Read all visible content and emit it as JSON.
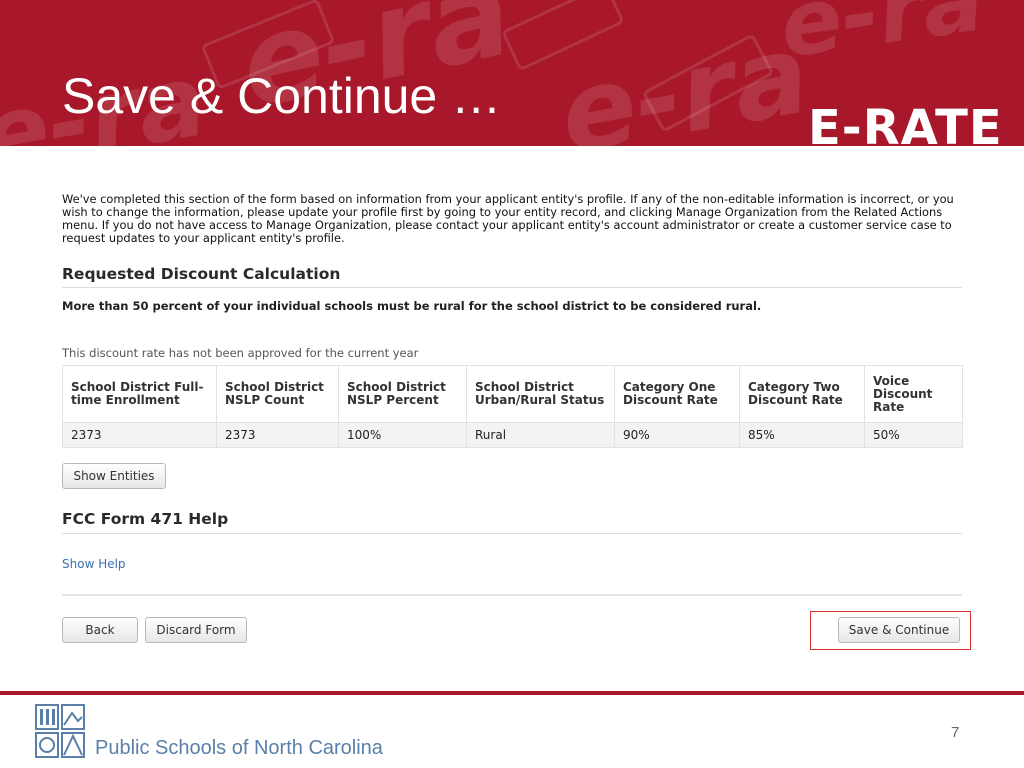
{
  "slide": {
    "title": "Save & Continue …",
    "brand": "E-RATE",
    "page_number": "7"
  },
  "form": {
    "intro": "We've completed this section of the form based on information from your applicant entity's profile.  If any of the non-editable information is incorrect, or you wish to change the information, please update your profile first by going to your entity record, and clicking Manage Organization from the Related Actions menu.  If you do not have access to Manage Organization, please contact your applicant entity's account administrator or create a customer service case to request updates to your applicant entity's profile.",
    "discount_section": {
      "heading": "Requested Discount Calculation",
      "rural_note": "More than 50 percent of your individual schools must be rural for the school district to be considered rural.",
      "approval_note": "This discount rate has not been approved for the current year",
      "table": {
        "headers": [
          "School District Full-time Enrollment",
          "School District NSLP Count",
          "School District NSLP Percent",
          "School District Urban/Rural Status",
          "Category One Discount Rate",
          "Category Two Discount Rate",
          "Voice Discount Rate"
        ],
        "row": [
          "2373",
          "2373",
          "100%",
          "Rural",
          "90%",
          "85%",
          "50%"
        ]
      },
      "show_entities_label": "Show Entities"
    },
    "help_section": {
      "heading": "FCC Form 471 Help",
      "show_help_label": "Show Help"
    },
    "actions": {
      "back_label": "Back",
      "discard_label": "Discard Form",
      "save_continue_label": "Save & Continue"
    }
  },
  "footer": {
    "organization": "Public Schools of North Carolina"
  },
  "colors": {
    "banner_red": "#a8182a",
    "link_blue": "#3a6fb0",
    "highlight_red": "#e03030"
  }
}
